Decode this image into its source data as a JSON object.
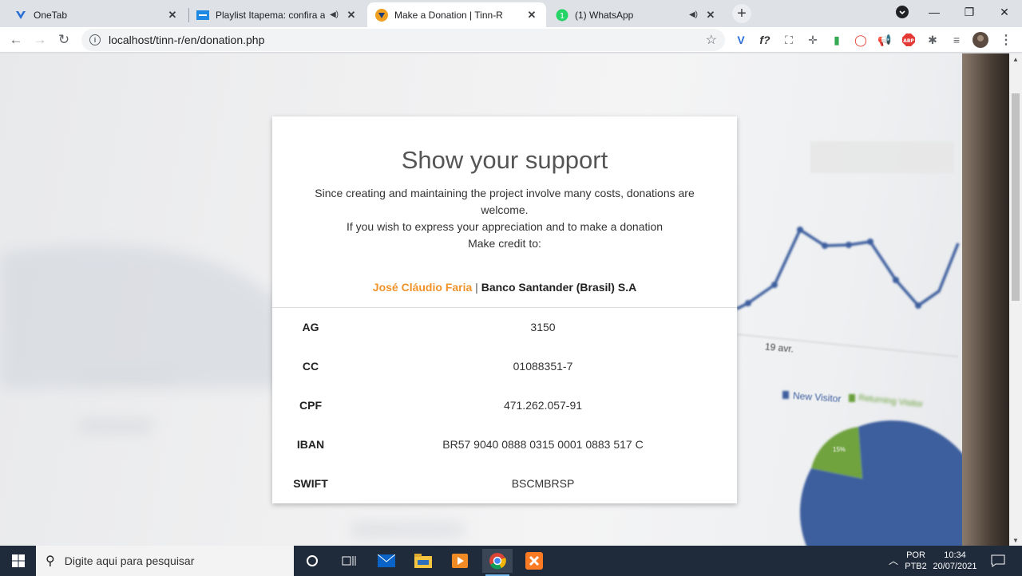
{
  "browser": {
    "tabs": [
      {
        "title": "OneTab",
        "active": false,
        "audio": false
      },
      {
        "title": "Playlist Itapema: confira a pro",
        "active": false,
        "audio": true
      },
      {
        "title": "Make a Donation | Tinn-R",
        "active": true,
        "audio": false
      },
      {
        "title": "(1) WhatsApp",
        "active": false,
        "audio": true
      }
    ],
    "url": "localhost/tinn-r/en/donation.php",
    "new_tab_label": "+"
  },
  "page": {
    "heading": "Show your support",
    "intro_line1": "Since creating and maintaining the project involve many costs, donations are welcome.",
    "intro_line2": "If you wish to express your appreciation and to make a donation",
    "intro_line3": "Make credit to:",
    "payee_name": "José Cláudio Faria",
    "payee_separator": "|",
    "bank": "Banco Santander (Brasil) S.A",
    "accent_color": "#f0932b",
    "details": [
      {
        "label": "AG",
        "value": "3150"
      },
      {
        "label": "CC",
        "value": "01088351-7"
      },
      {
        "label": "CPF",
        "value": "471.262.057-91"
      },
      {
        "label": "IBAN",
        "value": "BR57 9040 0888 0315 0001 0883 517 C"
      },
      {
        "label": "SWIFT",
        "value": "BSCMBRSP"
      }
    ]
  },
  "background_photo": {
    "date_label": "19 avr.",
    "legend_new": "New Visitor",
    "legend_returning": "Returning Visitor",
    "pie_label": "15%"
  },
  "taskbar": {
    "search_placeholder": "Digite aqui para pesquisar",
    "lang_top": "POR",
    "lang_bottom": "PTB2",
    "time": "10:34",
    "date": "20/07/2021"
  }
}
